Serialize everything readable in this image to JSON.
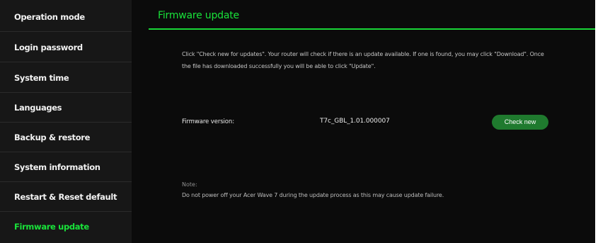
{
  "sidebar": {
    "items": [
      {
        "label": "Operation mode"
      },
      {
        "label": "Login password"
      },
      {
        "label": "System time"
      },
      {
        "label": "Languages"
      },
      {
        "label": "Backup & restore"
      },
      {
        "label": "System information"
      },
      {
        "label": "Restart & Reset default"
      },
      {
        "label": "Firmware update",
        "active": true
      }
    ]
  },
  "main": {
    "title": "Firmware update",
    "description_line1": "Click \"Check new for updates\". Your router will check if there is an update available. If one is found, you may click \"Download\". Once",
    "description_line2": "the file has downloaded successfully you will be able to click \"Update\".",
    "firmware_label": "Firmware version:",
    "firmware_value": "T7c_GBL_1.01.000007",
    "check_button": "Check new",
    "note_label": "Note:",
    "note_text": "Do not power off your Acer Wave 7 during the update process as this may cause update failure."
  },
  "colors": {
    "accent": "#19e33a",
    "button": "#1f7a2e",
    "background": "#0b0b0b",
    "sidebar": "#171717"
  }
}
